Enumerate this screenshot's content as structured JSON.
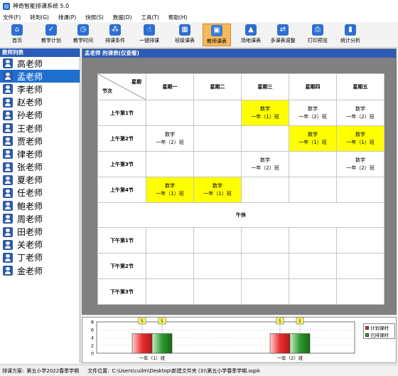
{
  "window": {
    "title": "神奇智能排课系统 5.0"
  },
  "menu": [
    "文件(F)",
    "转到(G)",
    "排课(P)",
    "快照(S)",
    "数据(D)",
    "工具(T)",
    "帮助(H)"
  ],
  "toolbar": [
    {
      "label": "首页",
      "icon": "home-icon"
    },
    {
      "label": "教学计划",
      "icon": "plan-icon"
    },
    {
      "label": "教学时间",
      "icon": "clock-icon"
    },
    {
      "label": "排课条件",
      "icon": "conditions-icon"
    },
    {
      "label": "一键排课",
      "icon": "hand-pointer-icon"
    },
    {
      "label": "班级课表",
      "icon": "calendar-grid-icon"
    },
    {
      "label": "教师课表",
      "icon": "teacher-schedule-icon",
      "active": true
    },
    {
      "label": "场地课表",
      "icon": "venue-icon"
    },
    {
      "label": "多课表调整",
      "icon": "multi-adjust-icon"
    },
    {
      "label": "打印预览",
      "icon": "printer-icon"
    },
    {
      "label": "统计分析",
      "icon": "stats-icon"
    }
  ],
  "teacher_list": {
    "header": "教师列表",
    "teachers": [
      "高老师",
      "孟老师",
      "李老师",
      "赵老师",
      "孙老师",
      "王老师",
      "贾老师",
      "律老师",
      "张老师",
      "夏老师",
      "任老师",
      "鲍老师",
      "周老师",
      "田老师",
      "关老师",
      "丁老师",
      "金老师"
    ],
    "selected": "孟老师"
  },
  "schedule": {
    "header": "孟老师 的课表(仅查看)",
    "corner_top": "星期",
    "corner_bottom": "节次",
    "days": [
      "星期一",
      "星期二",
      "星期三",
      "星期四",
      "星期五"
    ],
    "lunch": "午休",
    "morning": [
      {
        "period": "上午第1节",
        "cells": [
          null,
          null,
          {
            "subject": "数学",
            "class": "一年（1）班",
            "highlight": true
          },
          {
            "subject": "数学",
            "class": "一年（2）班",
            "highlight": false
          },
          {
            "subject": "数学",
            "class": "一年（2）班",
            "highlight": false
          }
        ]
      },
      {
        "period": "上午第2节",
        "cells": [
          {
            "subject": "数学",
            "class": "一年（2）班",
            "highlight": false
          },
          null,
          null,
          {
            "subject": "数学",
            "class": "一年（1）班",
            "highlight": true
          },
          {
            "subject": "数学",
            "class": "一年（1）班",
            "highlight": true
          }
        ]
      },
      {
        "period": "上午第3节",
        "cells": [
          null,
          null,
          {
            "subject": "数学",
            "class": "一年（2）班",
            "highlight": false
          },
          null,
          {
            "subject": "数学",
            "class": "一年（2）班",
            "highlight": false
          }
        ]
      },
      {
        "period": "上午第4节",
        "cells": [
          {
            "subject": "数学",
            "class": "一年（1）班",
            "highlight": true
          },
          {
            "subject": "数学",
            "class": "一年（1）班",
            "highlight": true
          },
          null,
          null,
          null
        ]
      }
    ],
    "afternoon": [
      {
        "period": "下午第1节",
        "cells": [
          null,
          null,
          null,
          null,
          null
        ]
      },
      {
        "period": "下午第2节",
        "cells": [
          null,
          null,
          null,
          null,
          null
        ]
      },
      {
        "period": "下午第3节",
        "cells": [
          null,
          null,
          null,
          null,
          null
        ]
      }
    ]
  },
  "chart_data": {
    "type": "bar",
    "categories": [
      "一年（1）班",
      "一年（2）班"
    ],
    "series": [
      {
        "name": "计划课时",
        "values": [
          5,
          5
        ],
        "color": "#e83030"
      },
      {
        "name": "已排课时",
        "values": [
          5,
          5
        ],
        "color": "#2f9a2f"
      }
    ],
    "ylim": [
      0,
      8
    ],
    "yticks": [
      0,
      2,
      4,
      6,
      8
    ],
    "grid": true,
    "legend": "top-right"
  },
  "status": {
    "plan_label": "排课方案:",
    "plan_value": "第五小学2022春季学期",
    "file_label": "文件位置:",
    "file_value": "C:\\Users\\cuilm\\Desktop\\新建文件夹 (3)\\第五小学春季学期.sqpk"
  }
}
